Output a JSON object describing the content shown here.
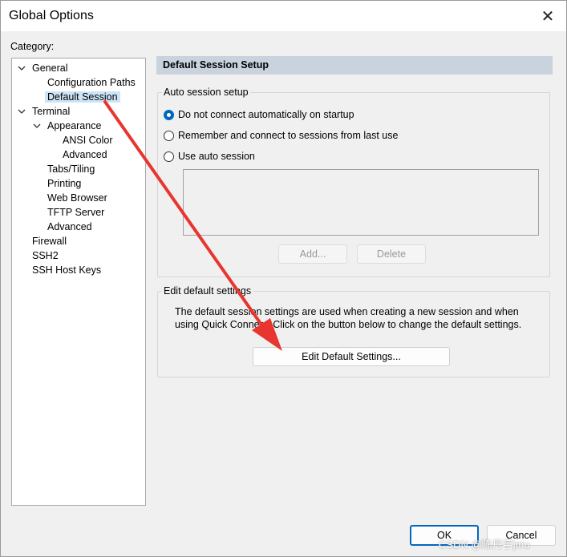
{
  "window": {
    "title": "Global Options",
    "close_glyph": "✕"
  },
  "category": {
    "label": "Category:",
    "tree": [
      {
        "label": "General",
        "expanded": true
      },
      {
        "label": "Configuration Paths"
      },
      {
        "label": "Default Session",
        "selected": true
      },
      {
        "label": "Terminal",
        "expanded": true
      },
      {
        "label": "Appearance",
        "expanded": true
      },
      {
        "label": "ANSI Color"
      },
      {
        "label": "Advanced"
      },
      {
        "label": "Tabs/Tiling"
      },
      {
        "label": "Printing"
      },
      {
        "label": "Web Browser"
      },
      {
        "label": "TFTP Server"
      },
      {
        "label": "Advanced"
      },
      {
        "label": "Firewall"
      },
      {
        "label": "SSH2"
      },
      {
        "label": "SSH Host Keys"
      }
    ]
  },
  "panel": {
    "header": "Default Session Setup",
    "auto_session": {
      "title": "Auto session setup",
      "options": [
        {
          "label": "Do not connect automatically on startup",
          "checked": true
        },
        {
          "label": "Remember and connect to sessions from last use",
          "checked": false
        },
        {
          "label": "Use auto session",
          "checked": false
        }
      ],
      "add_label": "Add...",
      "delete_label": "Delete"
    },
    "edit_defaults": {
      "title": "Edit default settings",
      "description": "The default session settings are used when creating a new session and when using Quick Connect. Click on the button below to change the default settings.",
      "button_label": "Edit Default Settings..."
    }
  },
  "footer": {
    "ok_label": "OK",
    "cancel_label": "Cancel"
  },
  "watermark": "CSDN @陈丹宇jmu",
  "colors": {
    "arrow": "#e8352f",
    "selection": "#cce4f7",
    "header_bar": "#c9d3de",
    "radio_checked": "#0067c0"
  }
}
